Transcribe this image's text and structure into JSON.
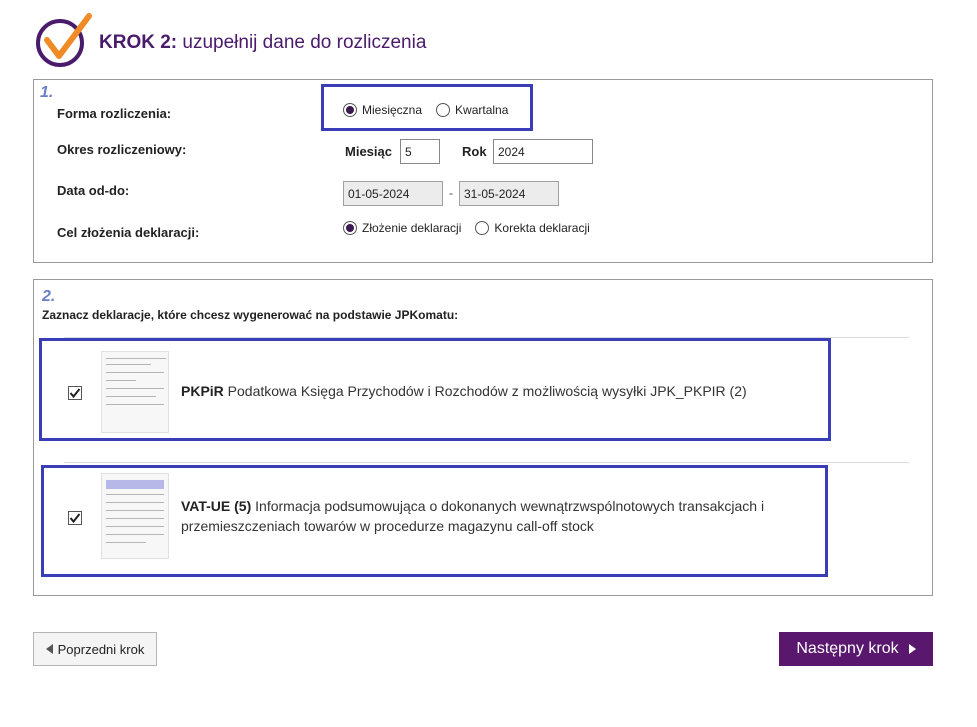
{
  "header": {
    "step_bold": "KROK 2:",
    "step_text": " uzupełnij dane do rozliczenia",
    "logo_icon": "checkmark-circle-logo",
    "brand_colors": {
      "primary": "#4a1a6b",
      "accent": "#f08a24",
      "highlight": "#3a3db8"
    }
  },
  "section1": {
    "number": "1.",
    "forma": {
      "label": "Forma rozliczenia:",
      "options": [
        {
          "label": "Miesięczna",
          "checked": true
        },
        {
          "label": "Kwartalna",
          "checked": false
        }
      ]
    },
    "okres": {
      "label": "Okres rozliczeniowy:",
      "miesiac_label": "Miesiąc",
      "miesiac_value": "5",
      "rok_label": "Rok",
      "rok_value": "2024"
    },
    "data": {
      "label": "Data od-do:",
      "from": "01-05-2024",
      "separator": "-",
      "to": "31-05-2024"
    },
    "cel": {
      "label": "Cel złożenia deklaracji:",
      "options": [
        {
          "label": "Złożenie deklaracji",
          "checked": true
        },
        {
          "label": "Korekta deklaracji",
          "checked": false
        }
      ]
    }
  },
  "section2": {
    "number": "2.",
    "instruction": "Zaznacz deklaracje, które chcesz wygenerować na podstawie JPKomatu:",
    "declarations": [
      {
        "code": "PKPiR",
        "description": " Podatkowa Księga Przychodów i Rozchodów z możliwością wysyłki JPK_PKPIR (2)",
        "checked": true
      },
      {
        "code": "VAT-UE (5)",
        "description": " Informacja podsumowująca o dokonanych wewnątrzwspólnotowych transakcjach i przemieszczeniach towarów w procedurze magazynu call-off stock",
        "checked": true
      }
    ]
  },
  "footer": {
    "prev_label": "Poprzedni krok",
    "next_label": "Następny krok"
  }
}
